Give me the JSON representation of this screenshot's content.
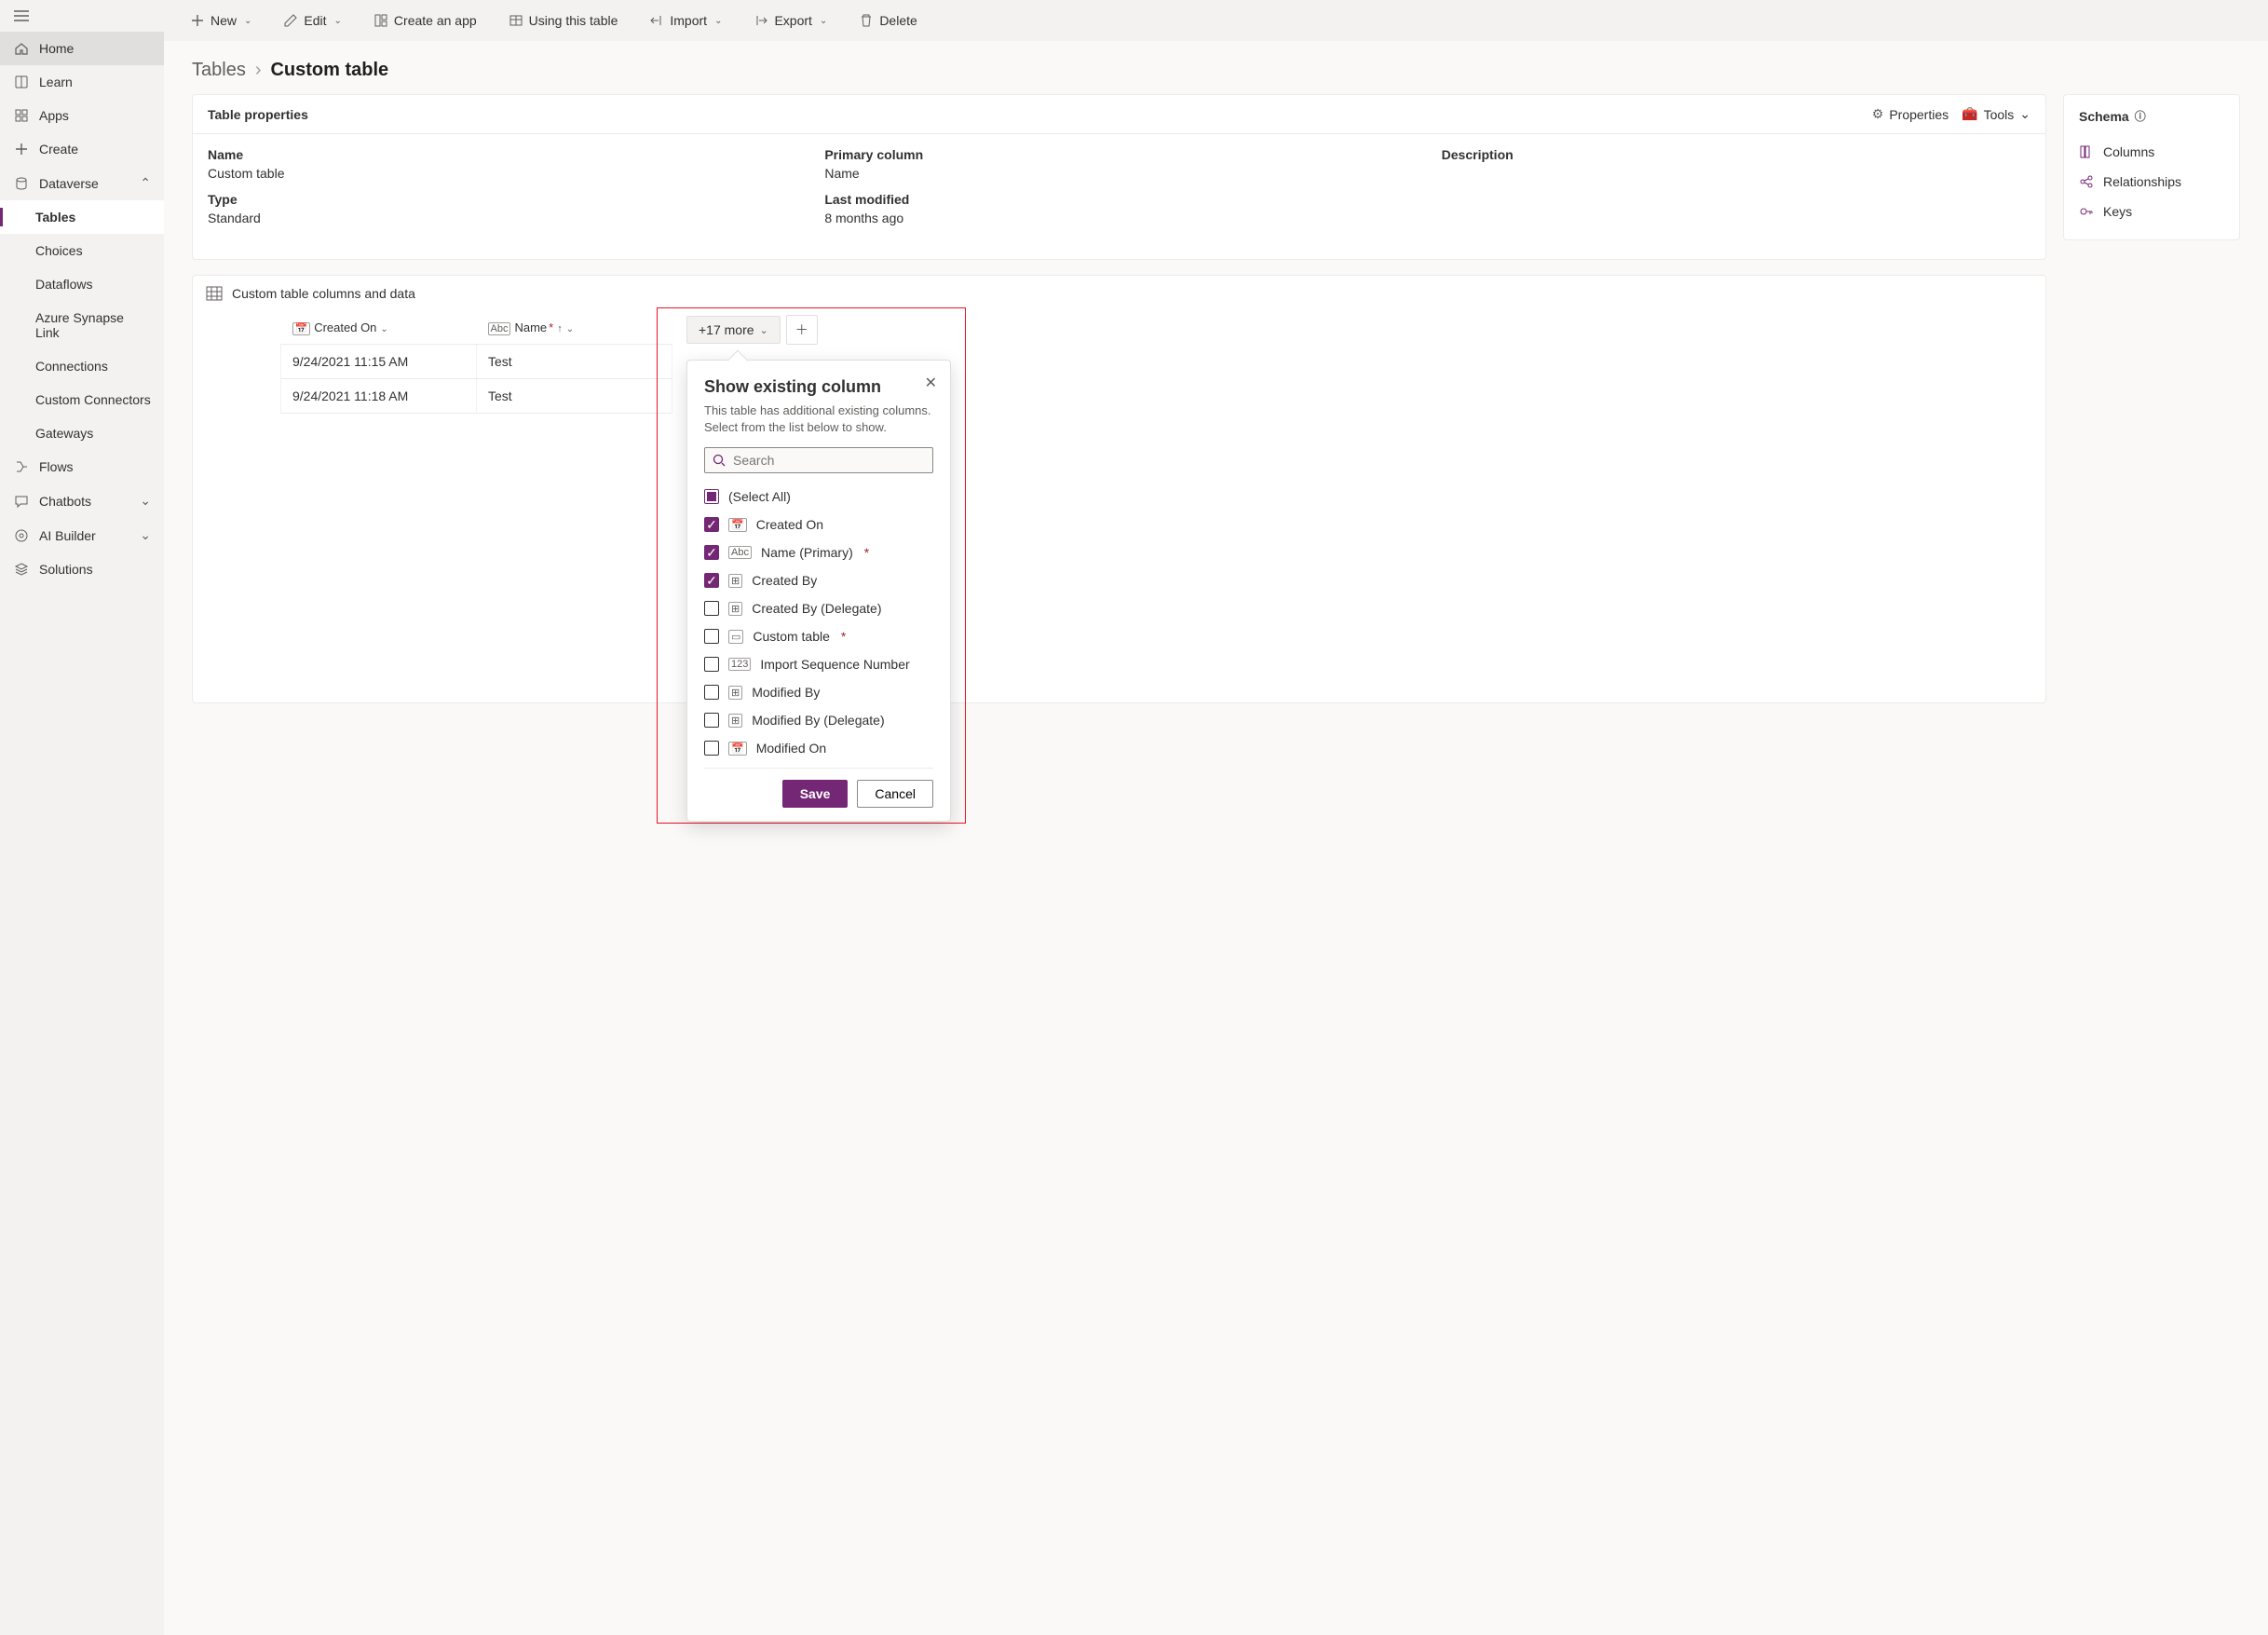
{
  "sidebar": {
    "items": [
      {
        "label": "Home",
        "icon": "home"
      },
      {
        "label": "Learn",
        "icon": "book"
      },
      {
        "label": "Apps",
        "icon": "grid"
      },
      {
        "label": "Create",
        "icon": "plus"
      },
      {
        "label": "Dataverse",
        "icon": "db",
        "expanded": true,
        "children": [
          {
            "label": "Tables",
            "selected": true
          },
          {
            "label": "Choices"
          },
          {
            "label": "Dataflows"
          },
          {
            "label": "Azure Synapse Link"
          },
          {
            "label": "Connections"
          },
          {
            "label": "Custom Connectors"
          },
          {
            "label": "Gateways"
          }
        ]
      },
      {
        "label": "Flows",
        "icon": "flow"
      },
      {
        "label": "Chatbots",
        "icon": "chat",
        "chevron": true
      },
      {
        "label": "AI Builder",
        "icon": "ai",
        "chevron": true
      },
      {
        "label": "Solutions",
        "icon": "layers"
      }
    ]
  },
  "commands": [
    {
      "label": "New",
      "icon": "plus",
      "chevron": true
    },
    {
      "label": "Edit",
      "icon": "pencil",
      "chevron": true
    },
    {
      "label": "Create an app",
      "icon": "app"
    },
    {
      "label": "Using this table",
      "icon": "table"
    },
    {
      "label": "Import",
      "icon": "import",
      "chevron": true
    },
    {
      "label": "Export",
      "icon": "export",
      "chevron": true
    },
    {
      "label": "Delete",
      "icon": "trash"
    }
  ],
  "breadcrumb": {
    "parent": "Tables",
    "current": "Custom table"
  },
  "tableProps": {
    "panelTitle": "Table properties",
    "propertiesLabel": "Properties",
    "toolsLabel": "Tools",
    "name": {
      "label": "Name",
      "value": "Custom table"
    },
    "primary": {
      "label": "Primary column",
      "value": "Name"
    },
    "description": {
      "label": "Description",
      "value": ""
    },
    "type": {
      "label": "Type",
      "value": "Standard"
    },
    "modified": {
      "label": "Last modified",
      "value": "8 months ago"
    }
  },
  "schema": {
    "title": "Schema",
    "links": [
      {
        "label": "Columns",
        "icon": "columns"
      },
      {
        "label": "Relationships",
        "icon": "share"
      },
      {
        "label": "Keys",
        "icon": "key"
      }
    ]
  },
  "dataGrid": {
    "title": "Custom table columns and data",
    "moreLabel": "+17 more",
    "columns": [
      {
        "label": "Created On",
        "typeIcon": "📅",
        "sort": false
      },
      {
        "label": "Name",
        "typeIcon": "Abc",
        "required": true,
        "sort": true
      }
    ],
    "rows": [
      {
        "created": "9/24/2021 11:15 AM",
        "name": "Test"
      },
      {
        "created": "9/24/2021 11:18 AM",
        "name": "Test"
      }
    ]
  },
  "popup": {
    "title": "Show existing column",
    "description": "This table has additional existing columns. Select from the list below to show.",
    "searchPlaceholder": "Search",
    "saveLabel": "Save",
    "cancelLabel": "Cancel",
    "items": [
      {
        "label": "(Select All)",
        "state": "indeterminate"
      },
      {
        "label": "Created On",
        "state": "checked",
        "icon": "📅"
      },
      {
        "label": "Name (Primary)",
        "state": "checked",
        "icon": "Abc",
        "required": true
      },
      {
        "label": "Created By",
        "state": "checked",
        "icon": "⊞"
      },
      {
        "label": "Created By (Delegate)",
        "state": "unchecked",
        "icon": "⊞"
      },
      {
        "label": "Custom table",
        "state": "unchecked",
        "icon": "▭",
        "required": true
      },
      {
        "label": "Import Sequence Number",
        "state": "unchecked",
        "icon": "123"
      },
      {
        "label": "Modified By",
        "state": "unchecked",
        "icon": "⊞"
      },
      {
        "label": "Modified By (Delegate)",
        "state": "unchecked",
        "icon": "⊞"
      },
      {
        "label": "Modified On",
        "state": "unchecked",
        "icon": "📅"
      }
    ]
  }
}
